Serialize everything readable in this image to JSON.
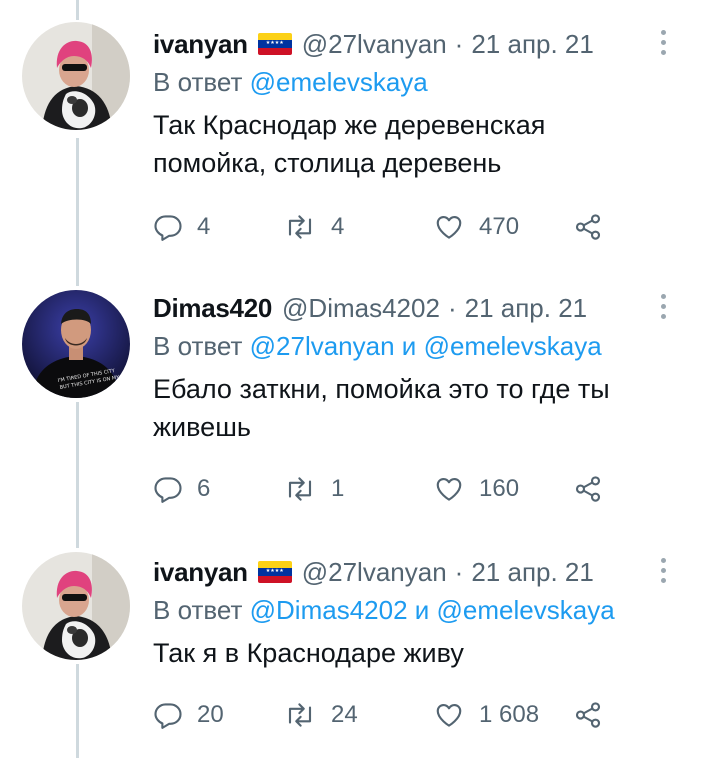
{
  "accent_color": "#1d9bf0",
  "tweets": [
    {
      "name": "ivanyan",
      "handle": "@27lvanyan",
      "separator": "·",
      "date": "21 апр. 21",
      "reply_prefix": "В ответ",
      "reply_mentions": "@emelevskaya",
      "text": "Так Краснодар же деревенская помойка, столица деревень",
      "replies": "4",
      "retweets": "4",
      "likes": "470",
      "has_flag": true
    },
    {
      "name": "Dimas420",
      "handle": "@Dimas4202",
      "separator": "·",
      "date": "21 апр. 21",
      "reply_prefix": "В ответ",
      "reply_mention_1": "@27lvanyan",
      "reply_and": "и",
      "reply_mention_2": "@emelevskaya",
      "text": "Ебало заткни, помойка это то где ты живешь",
      "replies": "6",
      "retweets": "1",
      "likes": "160",
      "has_flag": false,
      "avatar_shirt_text": "I'M TIRED OF THIS CITY BUT THIS CITY IS ON MY BACK"
    },
    {
      "name": "ivanyan",
      "handle": "@27lvanyan",
      "separator": "·",
      "date": "21 апр. 21",
      "reply_prefix": "В ответ",
      "reply_mention_1": "@Dimas4202",
      "reply_and": "и",
      "reply_mention_2": "@emelevskaya",
      "text": "Так я в Краснодаре живу",
      "replies": "20",
      "retweets": "24",
      "likes": "1 608",
      "has_flag": true
    }
  ]
}
